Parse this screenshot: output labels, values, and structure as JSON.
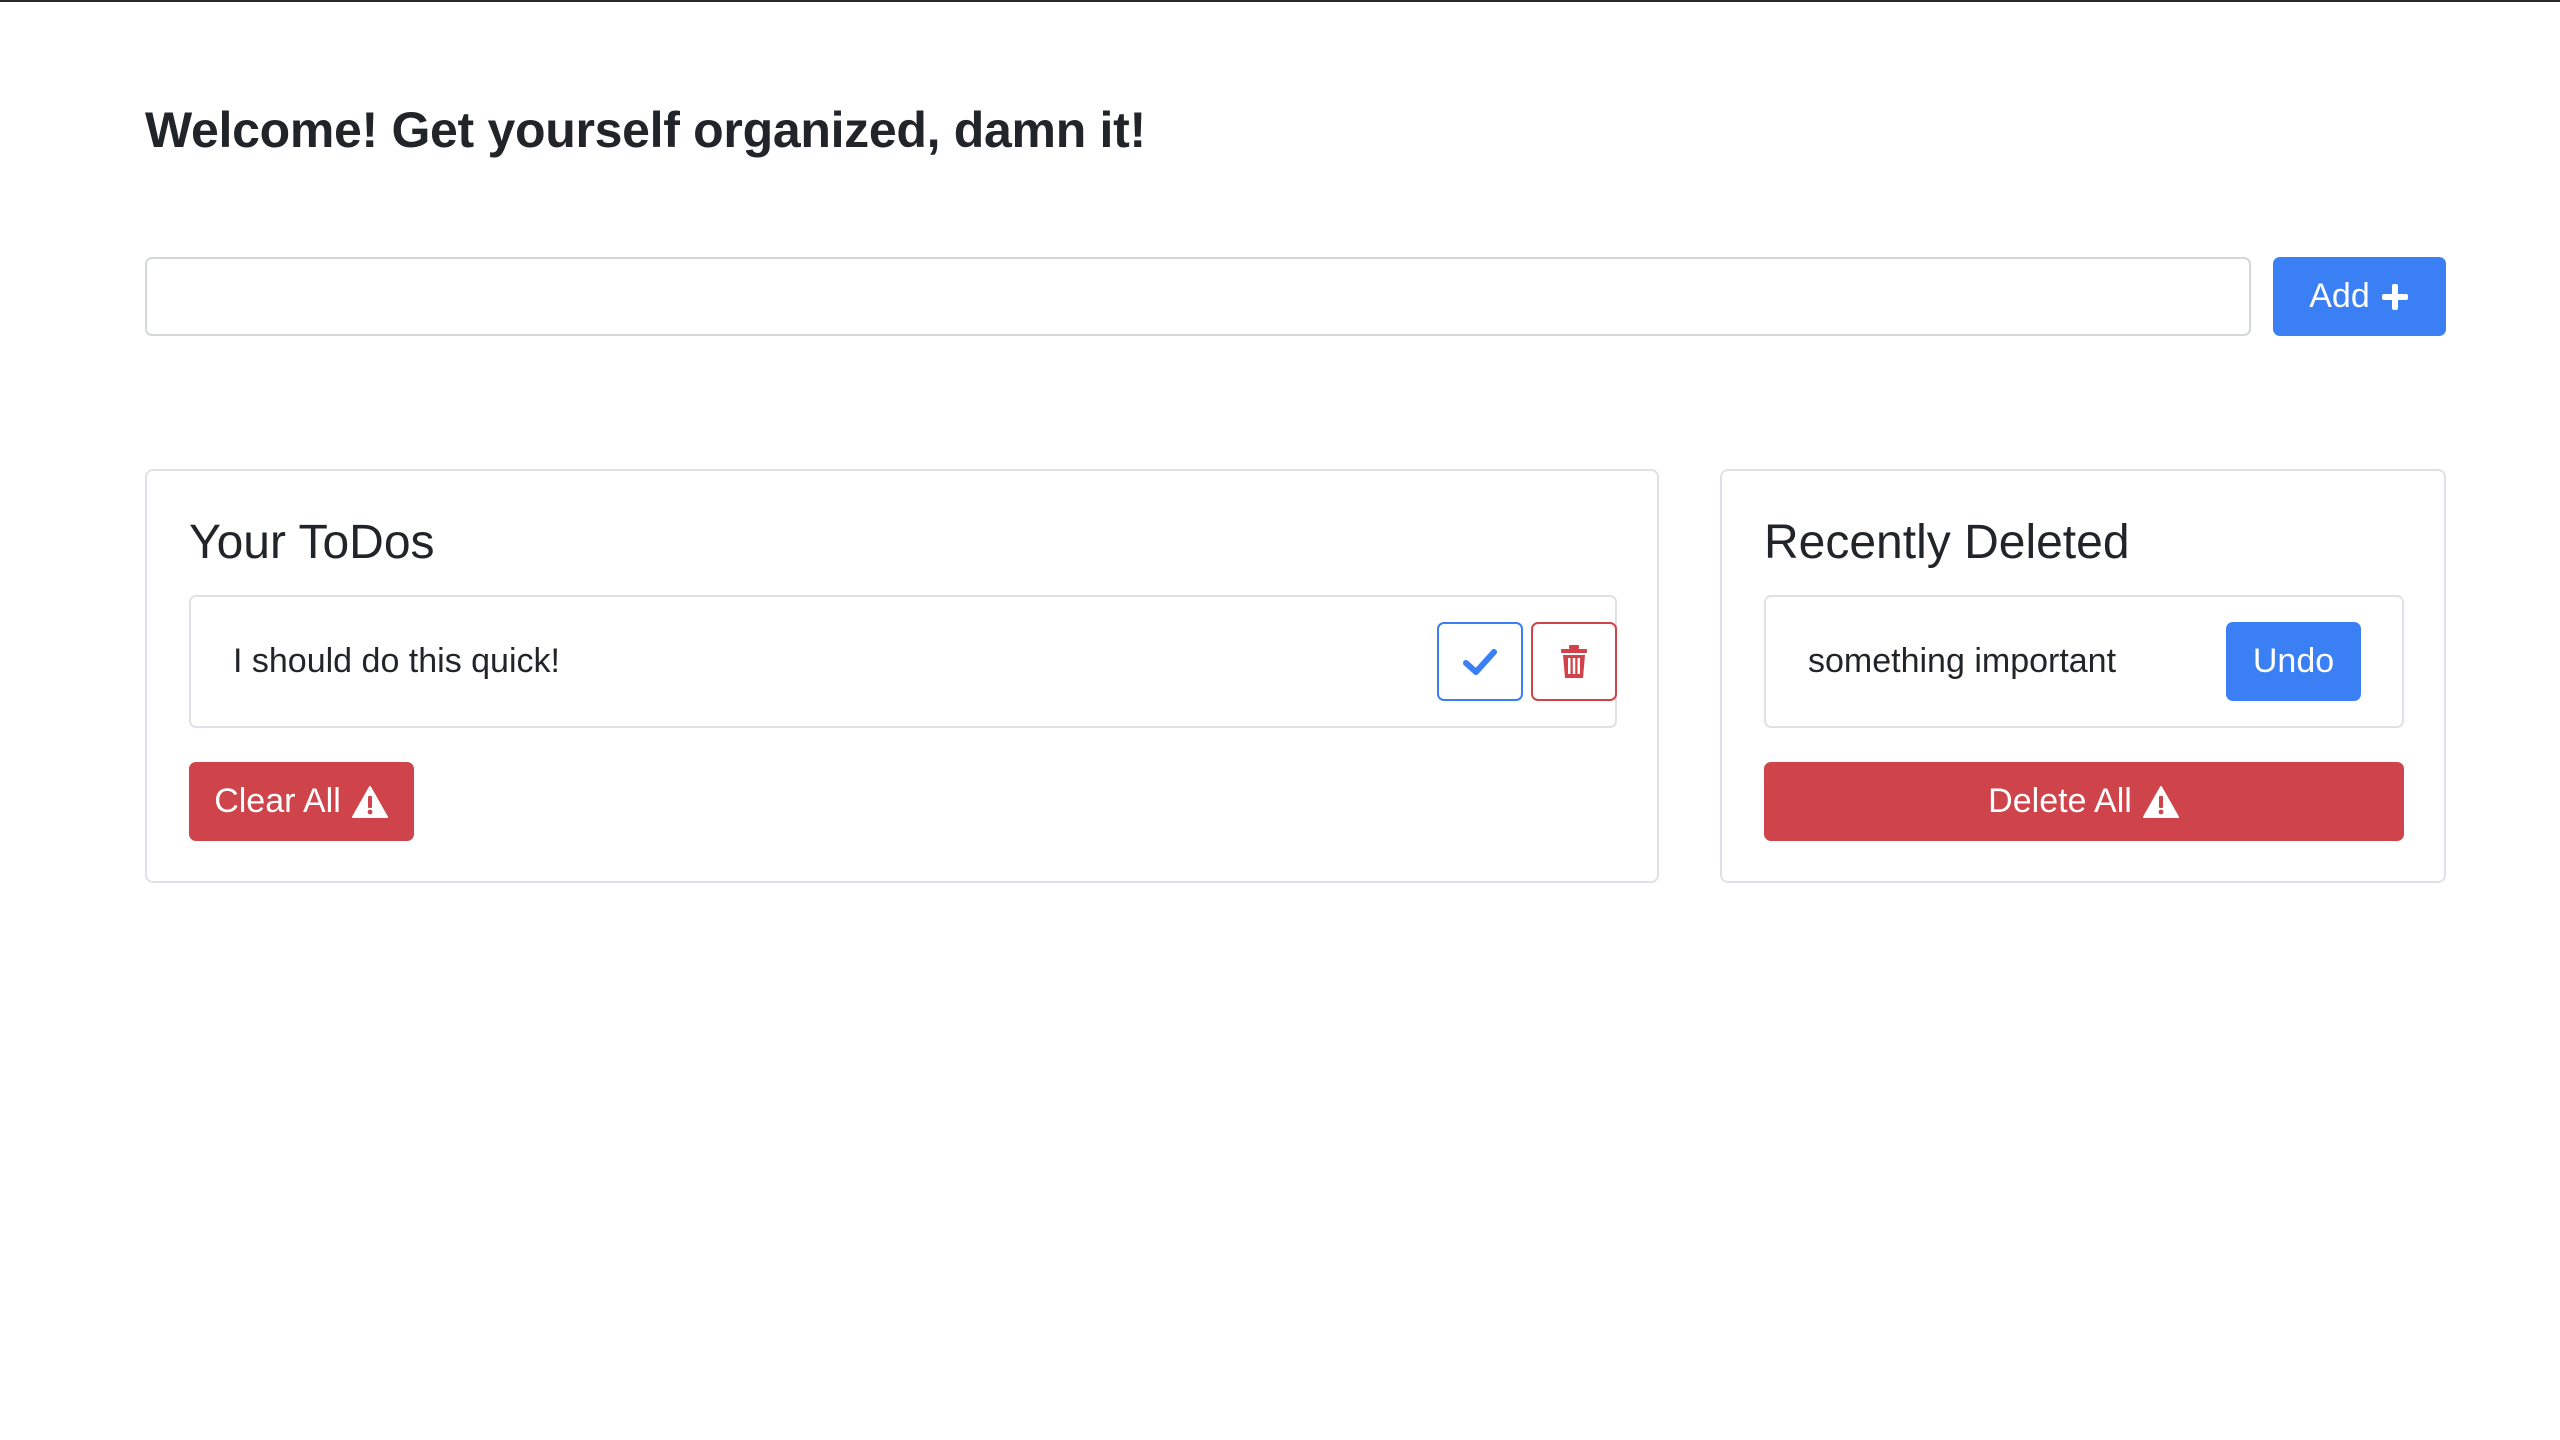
{
  "page": {
    "title": "Welcome! Get yourself organized, damn it!"
  },
  "new_todo": {
    "value": "",
    "placeholder": "",
    "add_label": "Add",
    "add_icon": "plus-icon"
  },
  "todos": {
    "title": "Your ToDos",
    "items": [
      {
        "text": "I should do this quick!",
        "complete_icon": "check-icon",
        "delete_icon": "trash-icon"
      }
    ],
    "clear_all_label": "Clear All",
    "clear_all_icon": "warning-icon"
  },
  "deleted": {
    "title": "Recently Deleted",
    "items": [
      {
        "text": "something important",
        "undo_label": "Undo"
      }
    ],
    "delete_all_label": "Delete All",
    "delete_all_icon": "warning-icon"
  },
  "colors": {
    "primary": "#3a7ff3",
    "danger": "#cf434b",
    "border": "#dee2e6",
    "text": "#212529"
  }
}
